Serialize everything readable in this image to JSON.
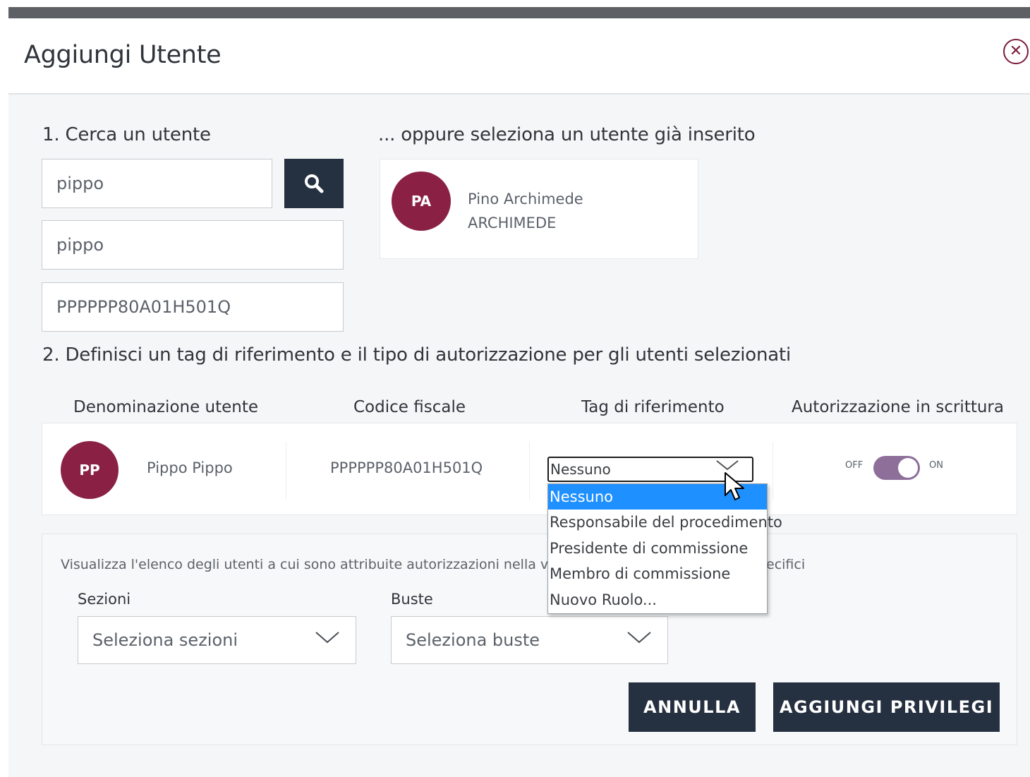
{
  "modal": {
    "title": "Aggiungi Utente",
    "close_icon": "close-circle-icon"
  },
  "search": {
    "section_label": "1. Cerca un utente",
    "query_value": "pippo",
    "search_icon": "search-icon",
    "name_value": "pippo",
    "fiscal_code_value": "PPPPPP80A01H501Q"
  },
  "existing": {
    "section_label": "... oppure seleziona un utente già inserito",
    "user": {
      "initials": "PA",
      "name": "Pino Archimede",
      "surname": "ARCHIMEDE"
    }
  },
  "permissions": {
    "section_label": "2. Definisci un tag di riferimento e il tipo di autorizzazione per gli utenti selezionati",
    "columns": [
      "Denominazione utente",
      "Codice fiscale",
      "Tag di riferimento",
      "Autorizzazione in scrittura"
    ],
    "row": {
      "initials": "PP",
      "name": "Pippo Pippo",
      "fiscal_code": "PPPPPP80A01H501Q",
      "tag_selected": "Nessuno",
      "toggle_off_label": "OFF",
      "toggle_on_label": "ON",
      "write_enabled": true
    },
    "tag_options": [
      "Nessuno",
      "Responsabile del procedimento",
      "Presidente di commissione",
      "Membro di commissione",
      "Nuovo Ruolo..."
    ]
  },
  "filters": {
    "info_text": "Visualizza l'elenco degli utenti a cui sono attribuite autorizzazioni nella v",
    "info_text_tail": "ecifici",
    "sections_label": "Sezioni",
    "sections_placeholder": "Seleziona sezioni",
    "envelopes_label": "Buste",
    "envelopes_placeholder": "Seleziona buste"
  },
  "actions": {
    "cancel_label": "ANNULLA",
    "submit_label": "AGGIUNGI PRIVILEGI"
  },
  "colors": {
    "avatar": "#8a2144",
    "button": "#253040",
    "toggle": "#8e6f9a",
    "dropdown_selected": "#1e90ff"
  }
}
